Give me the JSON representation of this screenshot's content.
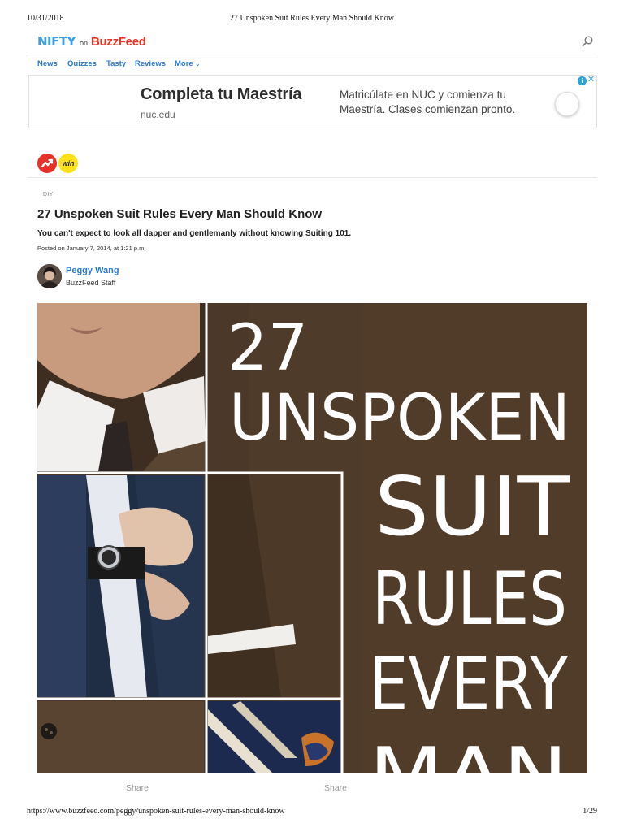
{
  "print_header": {
    "date": "10/31/2018",
    "title": "27 Unspoken Suit Rules Every Man Should Know"
  },
  "site": {
    "logo_nifty": "NIFTY",
    "logo_on": "on",
    "logo_buzzfeed": "BuzzFeed",
    "search_icon": "search-icon"
  },
  "nav": {
    "items": [
      "News",
      "Quizzes",
      "Tasty",
      "Reviews",
      "More"
    ]
  },
  "ad": {
    "title": "Completa tu Maestría",
    "domain": "nuc.edu",
    "body": "Matricúlate en NUC y comienza tu Maestría. Clases comienzan pronto.",
    "info_icon": "adchoices-icon",
    "close_icon": "close-icon"
  },
  "badges": {
    "trending_icon": "trending-icon",
    "win_label": "win"
  },
  "article": {
    "category": "DIY",
    "headline": "27 Unspoken Suit Rules Every Man Should Know",
    "dek": "You can't expect to look all dapper and gentlemanly without knowing Suiting 101.",
    "posted": "Posted on January 7, 2014, at 1:21 p.m."
  },
  "author": {
    "name": "Peggy Wang",
    "role": "BuzzFeed Staff"
  },
  "hero": {
    "lines": [
      "27",
      "UNSPOKEN",
      "SUIT",
      "RULES",
      "EVERY",
      "MAN"
    ]
  },
  "share": {
    "left": "Share",
    "right": "Share"
  },
  "print_footer": {
    "url": "https://www.buzzfeed.com/peggy/unspoken-suit-rules-every-man-should-know",
    "page": "1/29"
  },
  "colors": {
    "link_blue": "#2b7bd6",
    "buzzfeed_red": "#ee3322",
    "nifty_blue": "#3b9ee6",
    "win_yellow": "#ffe11a",
    "suit_brown": "#4e3a2a"
  }
}
